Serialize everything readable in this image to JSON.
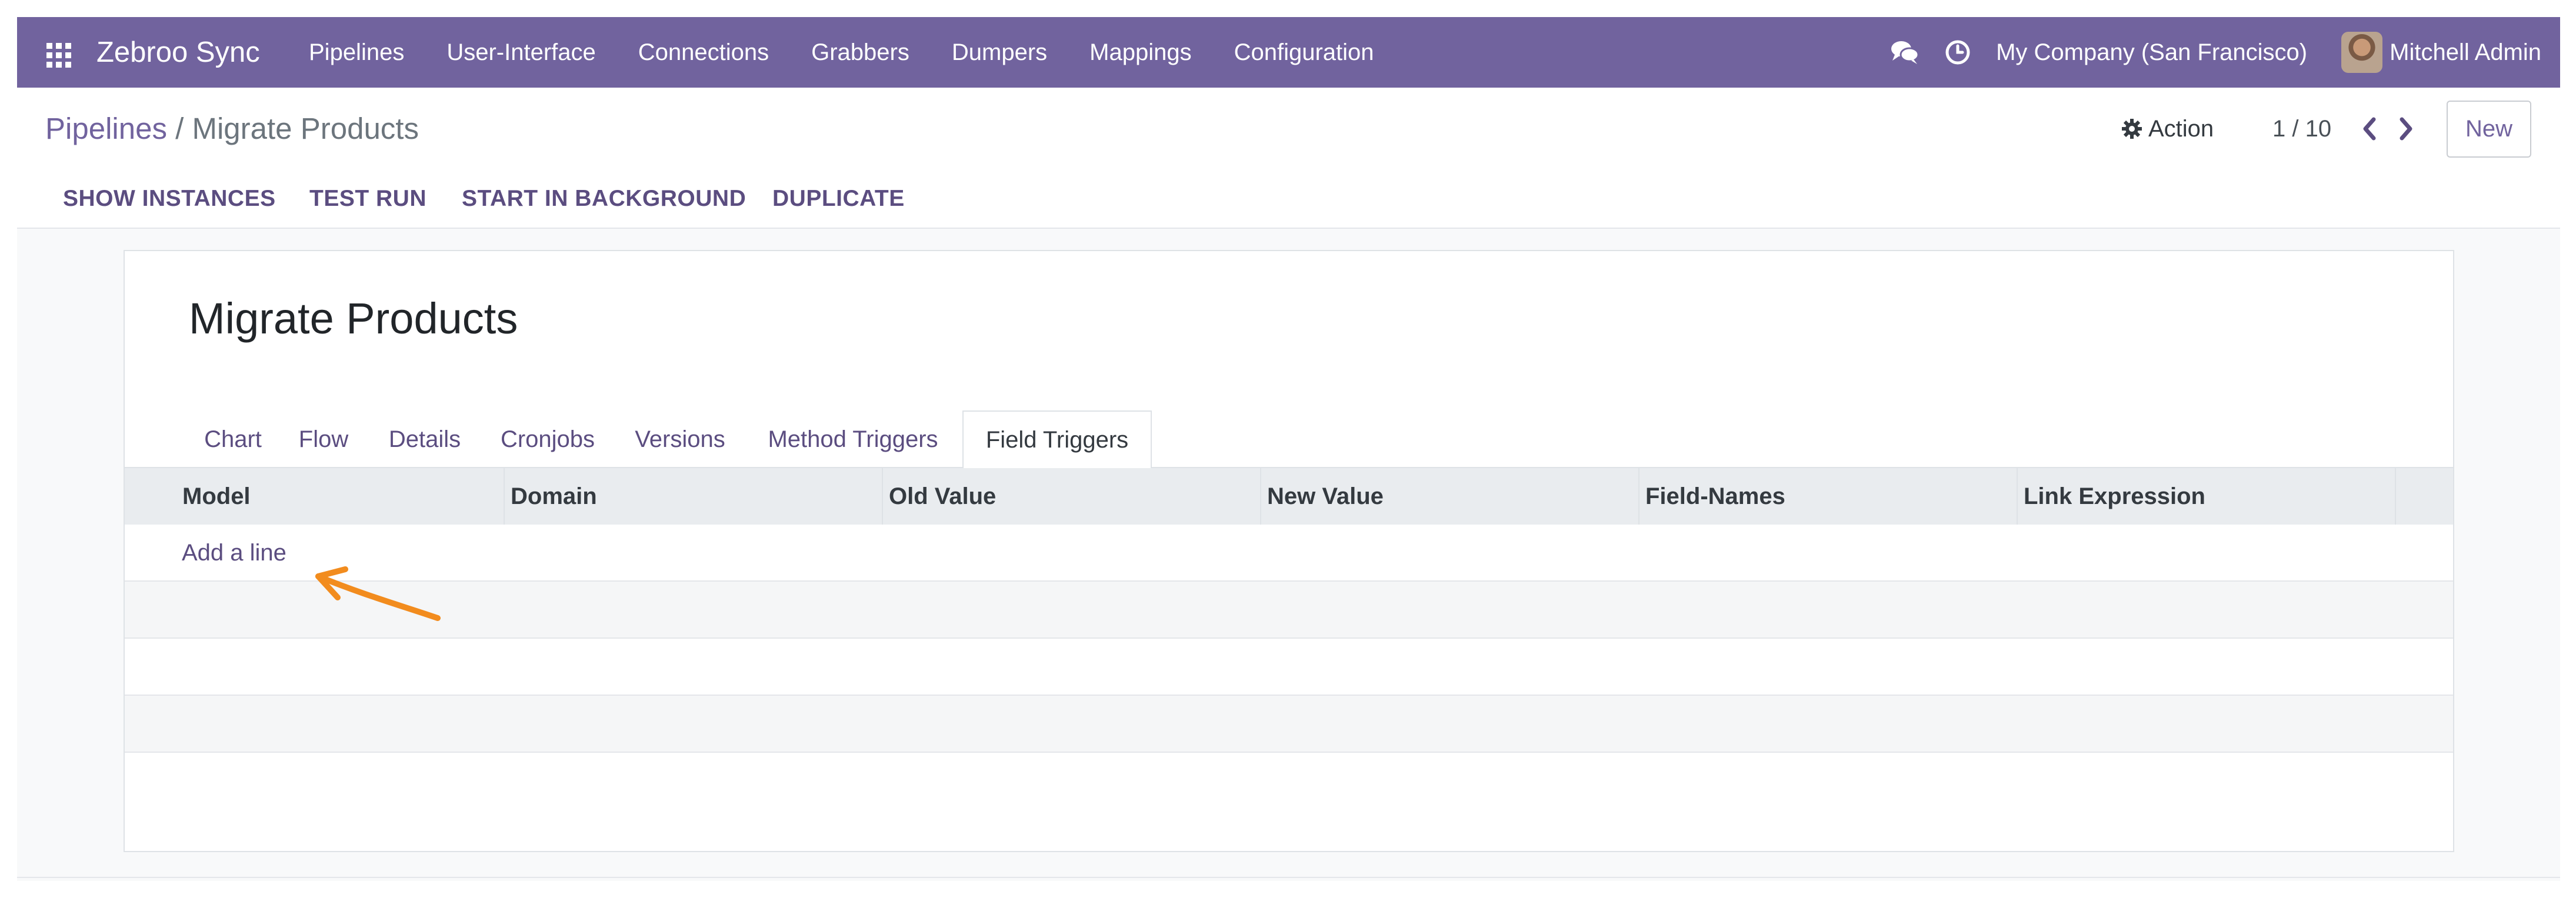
{
  "colors": {
    "brand": "#71639e",
    "annotation_arrow": "#f28c1e"
  },
  "navbar": {
    "apps_icon": "apps-grid-icon",
    "brand": "Zebroo Sync",
    "menu": [
      "Pipelines",
      "User-Interface",
      "Connections",
      "Grabbers",
      "Dumpers",
      "Mappings",
      "Configuration"
    ],
    "systray": {
      "messages_icon": "chat-bubbles-icon",
      "activity_icon": "clock-icon",
      "company": "My Company (San Francisco)",
      "user": "Mitchell Admin"
    }
  },
  "control_panel": {
    "breadcrumb_parent": "Pipelines",
    "breadcrumb_separator": "/",
    "breadcrumb_current": "Migrate Products",
    "action_label": "Action",
    "action_icon": "gear-icon",
    "pager": "1 / 10",
    "new_label": "New"
  },
  "header_buttons": [
    "SHOW INSTANCES",
    "TEST RUN",
    "START IN BACKGROUND",
    "DUPLICATE"
  ],
  "record": {
    "title": "Migrate Products",
    "tabs": [
      "Chart",
      "Flow",
      "Details",
      "Cronjobs",
      "Versions",
      "Method Triggers",
      "Field Triggers"
    ],
    "active_tab": "Field Triggers",
    "table": {
      "columns": [
        "Model",
        "Domain",
        "Old Value",
        "New Value",
        "Field-Names",
        "Link Expression"
      ],
      "add_line_label": "Add a line"
    }
  }
}
